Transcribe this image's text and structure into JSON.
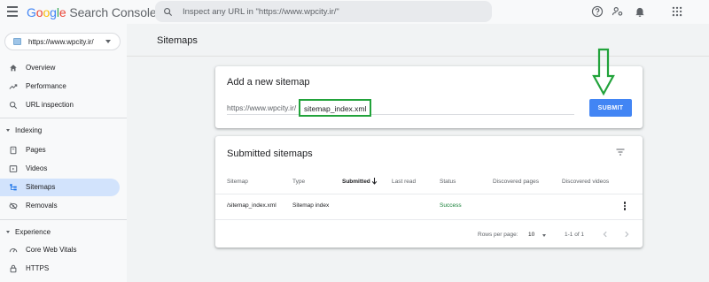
{
  "header": {
    "logo_google": [
      "G",
      "o",
      "o",
      "g",
      "l",
      "e"
    ],
    "logo_product": "Search Console",
    "search_placeholder": "Inspect any URL in \"https://www.wpcity.ir/\""
  },
  "sidebar": {
    "property": "https://www.wpcity.ir/",
    "items_top": [
      {
        "label": "Overview",
        "icon": "home-icon"
      },
      {
        "label": "Performance",
        "icon": "trending-up-icon"
      },
      {
        "label": "URL inspection",
        "icon": "search-icon"
      }
    ],
    "sections": [
      {
        "label": "Indexing",
        "items": [
          {
            "label": "Pages",
            "icon": "pages-icon"
          },
          {
            "label": "Videos",
            "icon": "video-icon"
          },
          {
            "label": "Sitemaps",
            "icon": "sitemap-icon",
            "active": true
          },
          {
            "label": "Removals",
            "icon": "removals-icon"
          }
        ]
      },
      {
        "label": "Experience",
        "items": [
          {
            "label": "Core Web Vitals",
            "icon": "speedometer-icon"
          },
          {
            "label": "HTTPS",
            "icon": "lock-icon"
          }
        ]
      }
    ]
  },
  "main": {
    "page_title": "Sitemaps",
    "add_card": {
      "title": "Add a new sitemap",
      "url_prefix": "https://www.wpcity.ir/",
      "input_value": "sitemap_index.xml",
      "submit_label": "SUBMIT",
      "highlight_color": "#22a33b"
    },
    "submitted_card": {
      "title": "Submitted sitemaps",
      "columns": [
        "Sitemap",
        "Type",
        "Submitted",
        "Last read",
        "Status",
        "Discovered pages",
        "Discovered videos"
      ],
      "sorted_column": "Submitted",
      "rows": [
        {
          "sitemap": "/sitemap_index.xml",
          "type": "Sitemap index",
          "submitted": "",
          "last_read": "",
          "status": "Success",
          "pages": "",
          "videos": ""
        }
      ],
      "pagination": {
        "rows_per_page_label": "Rows per page:",
        "rows_per_page": "10",
        "range": "1-1 of 1"
      }
    }
  },
  "colors": {
    "accent": "#4285f4",
    "active_nav": "#d2e3fc",
    "success": "#188038",
    "annotation": "#22a33b"
  }
}
